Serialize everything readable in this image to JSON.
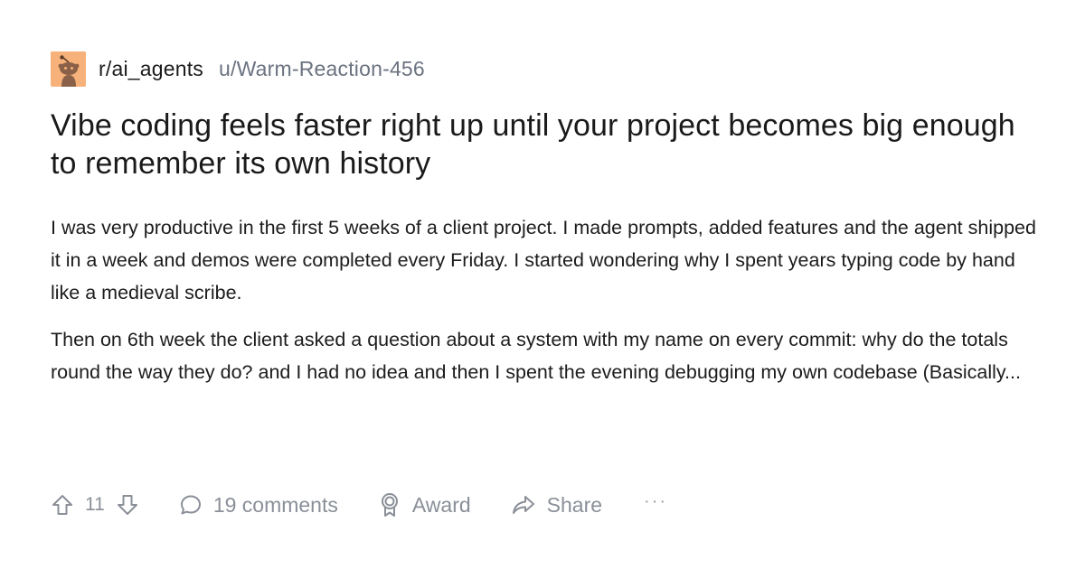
{
  "header": {
    "subreddit": "r/ai_agents",
    "username": "u/Warm-Reaction-456",
    "avatar_icon": "reddit-snoo-avatar-icon",
    "avatar_color": "#f7b17a"
  },
  "post": {
    "title": "Vibe coding feels faster right up until your project becomes big enough to remember its own history",
    "paragraphs": [
      "I was very productive in the first 5 weeks of a client project. I made prompts, added features and the agent shipped it in a week and demos were completed every Friday. I started wondering why I spent years typing code by hand like a medieval scribe.",
      "Then on 6th week the client asked a question about a system with my name on every commit: why do the totals round the way they do? and I had no idea and then I spent the evening debugging my own codebase (Basically..."
    ]
  },
  "actions": {
    "vote_count": "11",
    "comments_label": "19 comments",
    "award_label": "Award",
    "share_label": "Share",
    "more_label": "···",
    "icons": {
      "upvote": "upvote-arrow-icon",
      "downvote": "downvote-arrow-icon",
      "comments": "comment-bubble-icon",
      "award": "award-ribbon-icon",
      "share": "share-arrow-icon"
    },
    "muted_color": "#8a8f98"
  }
}
